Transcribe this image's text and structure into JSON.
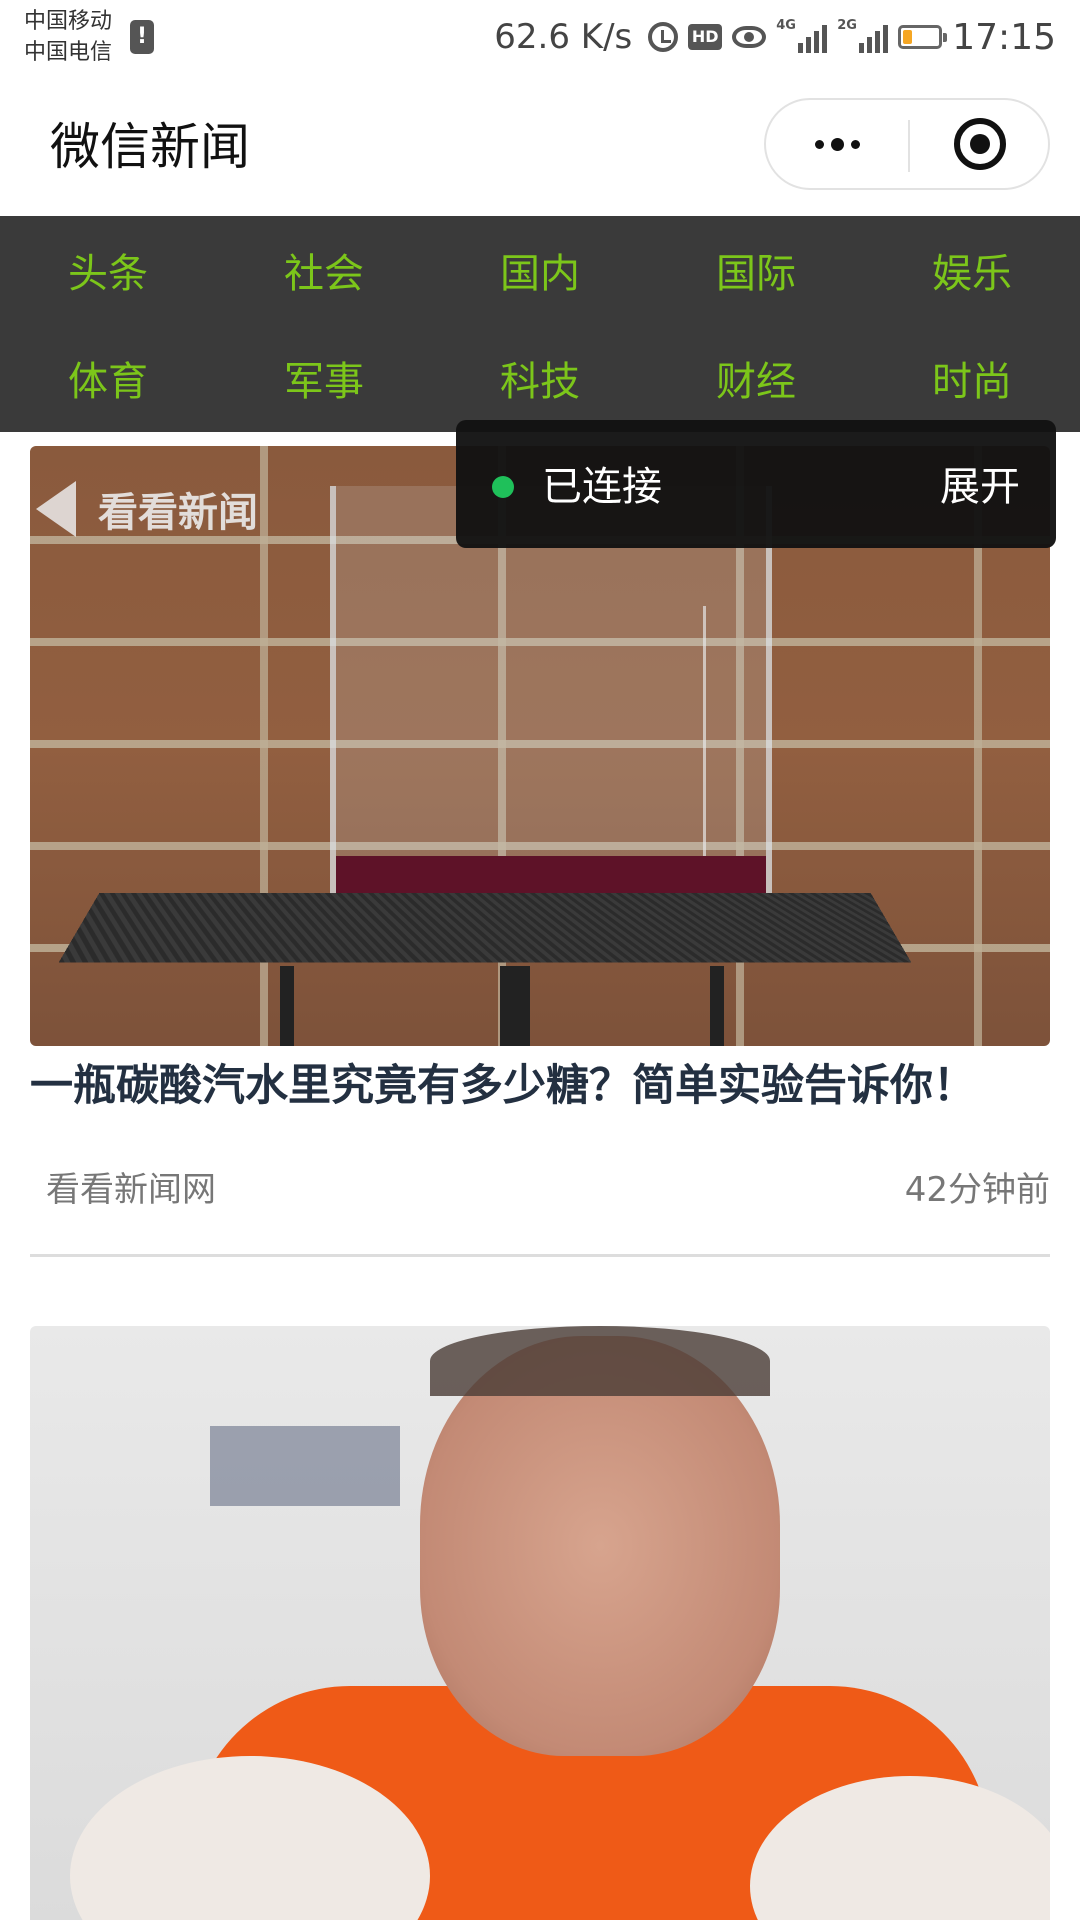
{
  "status_bar": {
    "carrier_1": "中国移动",
    "carrier_2": "中国电信",
    "sim_badge": "!",
    "net_speed": "62.6 K/s",
    "hd_label": "HD",
    "signal_1_tag": "4G",
    "signal_2_tag": "2G",
    "time": "17:15",
    "battery_color": "#f5a623",
    "icons": [
      "alarm-icon",
      "hd-icon",
      "eye-icon",
      "signal-icon",
      "battery-icon"
    ]
  },
  "title_bar": {
    "title": "微信新闻",
    "more_icon": "more-dots-icon",
    "close_icon": "target-icon"
  },
  "categories": [
    "头条",
    "社会",
    "国内",
    "国际",
    "娱乐",
    "体育",
    "军事",
    "科技",
    "财经",
    "时尚"
  ],
  "theme": {
    "category_bg": "#3a3a3a",
    "category_text": "#7cc61a",
    "headline_color": "#233041",
    "connected_color": "#1fc05a"
  },
  "connection_panel": {
    "status": "已连接",
    "expand_label": "展开"
  },
  "feed": [
    {
      "image_watermark": "看看新闻",
      "title": "一瓶碳酸汽水里究竟有多少糖？简单实验告诉你！",
      "source": "看看新闻网",
      "time_ago": "42分钟前"
    }
  ]
}
